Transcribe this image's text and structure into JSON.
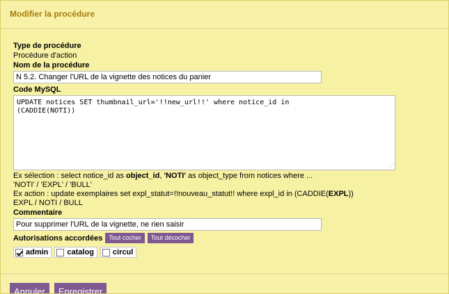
{
  "header": {
    "title": "Modifier la procédure"
  },
  "procedure_type": {
    "label": "Type de procédure",
    "value": "Procédure d'action"
  },
  "procedure_name": {
    "label": "Nom de la procédure",
    "value": "N 5.2. Changer l'URL de la vignette des notices du panier"
  },
  "mysql_code": {
    "label": "Code MySQL",
    "value": "UPDATE notices SET thumbnail_url='!!new_url!!' where notice_id in\n(CADDIE(NOTI))"
  },
  "help": {
    "selection_prefix": "Ex sélection : select notice_id as ",
    "selection_object_id": "object_id",
    "selection_sep": ", ",
    "selection_noti": "'NOTI'",
    "selection_suffix": " as object_type from notices where ...",
    "selection_types": "'NOTI' / 'EXPL' / 'BULL'",
    "action_prefix": "Ex action : update exemplaires set expl_statut=!!nouveau_statut!! where expl_id in (CADDIE(",
    "action_expl": "EXPL",
    "action_suffix": "))",
    "action_types": "EXPL / NOTI / BULL"
  },
  "comment": {
    "label": "Commentaire",
    "value": "Pour supprimer l'URL de la vignette, ne rien saisir"
  },
  "authorizations": {
    "label": "Autorisations accordées",
    "check_all": "Tout cocher",
    "uncheck_all": "Tout décocher",
    "items": [
      {
        "label": "admin",
        "checked": true
      },
      {
        "label": "catalog",
        "checked": false
      },
      {
        "label": "circul",
        "checked": false
      }
    ]
  },
  "footer": {
    "cancel_label": "Annuler",
    "save_label": "Enregistrer"
  },
  "colors": {
    "panel_background": "#f7f1a4",
    "title_color": "#a67c0b",
    "button_purple": "#7e5992"
  },
  "icons": {
    "textarea_resize": "resize-grip-icon",
    "checked_box": "checkbox-checked-icon",
    "unchecked_box": "checkbox-unchecked-icon"
  }
}
